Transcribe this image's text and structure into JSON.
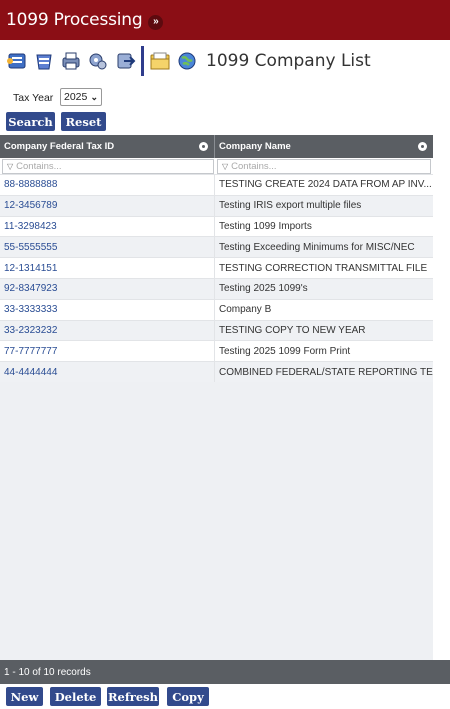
{
  "header": {
    "title": "1099 Processing",
    "expand_glyph": "»"
  },
  "toolbar": {
    "icons": [
      "forms-icon",
      "bin-icon",
      "printer-icon",
      "gears-icon",
      "export-icon",
      "folder-icon",
      "globe-icon"
    ],
    "page_title": "1099 Company List"
  },
  "filters": {
    "tax_year_label": "Tax Year",
    "tax_year_value": "2025",
    "search_label": "Search",
    "reset_label": "Reset"
  },
  "grid": {
    "columns": [
      "Company Federal Tax ID",
      "Company Name"
    ],
    "filter_placeholder": "Contains...",
    "rows": [
      {
        "tax_id": "88-8888888",
        "name": "TESTING CREATE 2024 DATA FROM AP INV..."
      },
      {
        "tax_id": "12-3456789",
        "name": "Testing IRIS export multiple files"
      },
      {
        "tax_id": "11-3298423",
        "name": "Testing 1099 Imports"
      },
      {
        "tax_id": "55-5555555",
        "name": "Testing Exceeding Minimums for MISC/NEC"
      },
      {
        "tax_id": "12-1314151",
        "name": "TESTING CORRECTION TRANSMITTAL FILE"
      },
      {
        "tax_id": "92-8347923",
        "name": "Testing 2025 1099's"
      },
      {
        "tax_id": "33-3333333",
        "name": "Company B"
      },
      {
        "tax_id": "33-2323232",
        "name": "TESTING COPY TO NEW YEAR"
      },
      {
        "tax_id": "77-7777777",
        "name": "Testing 2025 1099 Form Print"
      },
      {
        "tax_id": "44-4444444",
        "name": "COMBINED FEDERAL/STATE REPORTING TE..."
      }
    ]
  },
  "pager": {
    "text": "1 - 10 of 10 records"
  },
  "actions": {
    "new_label": "New",
    "delete_label": "Delete",
    "refresh_label": "Refresh",
    "copy_label": "Copy"
  },
  "colors": {
    "titlebar": "#8b0e15",
    "button": "#324a8c",
    "grid_header": "#5a5e63",
    "link": "#2a4d94"
  }
}
